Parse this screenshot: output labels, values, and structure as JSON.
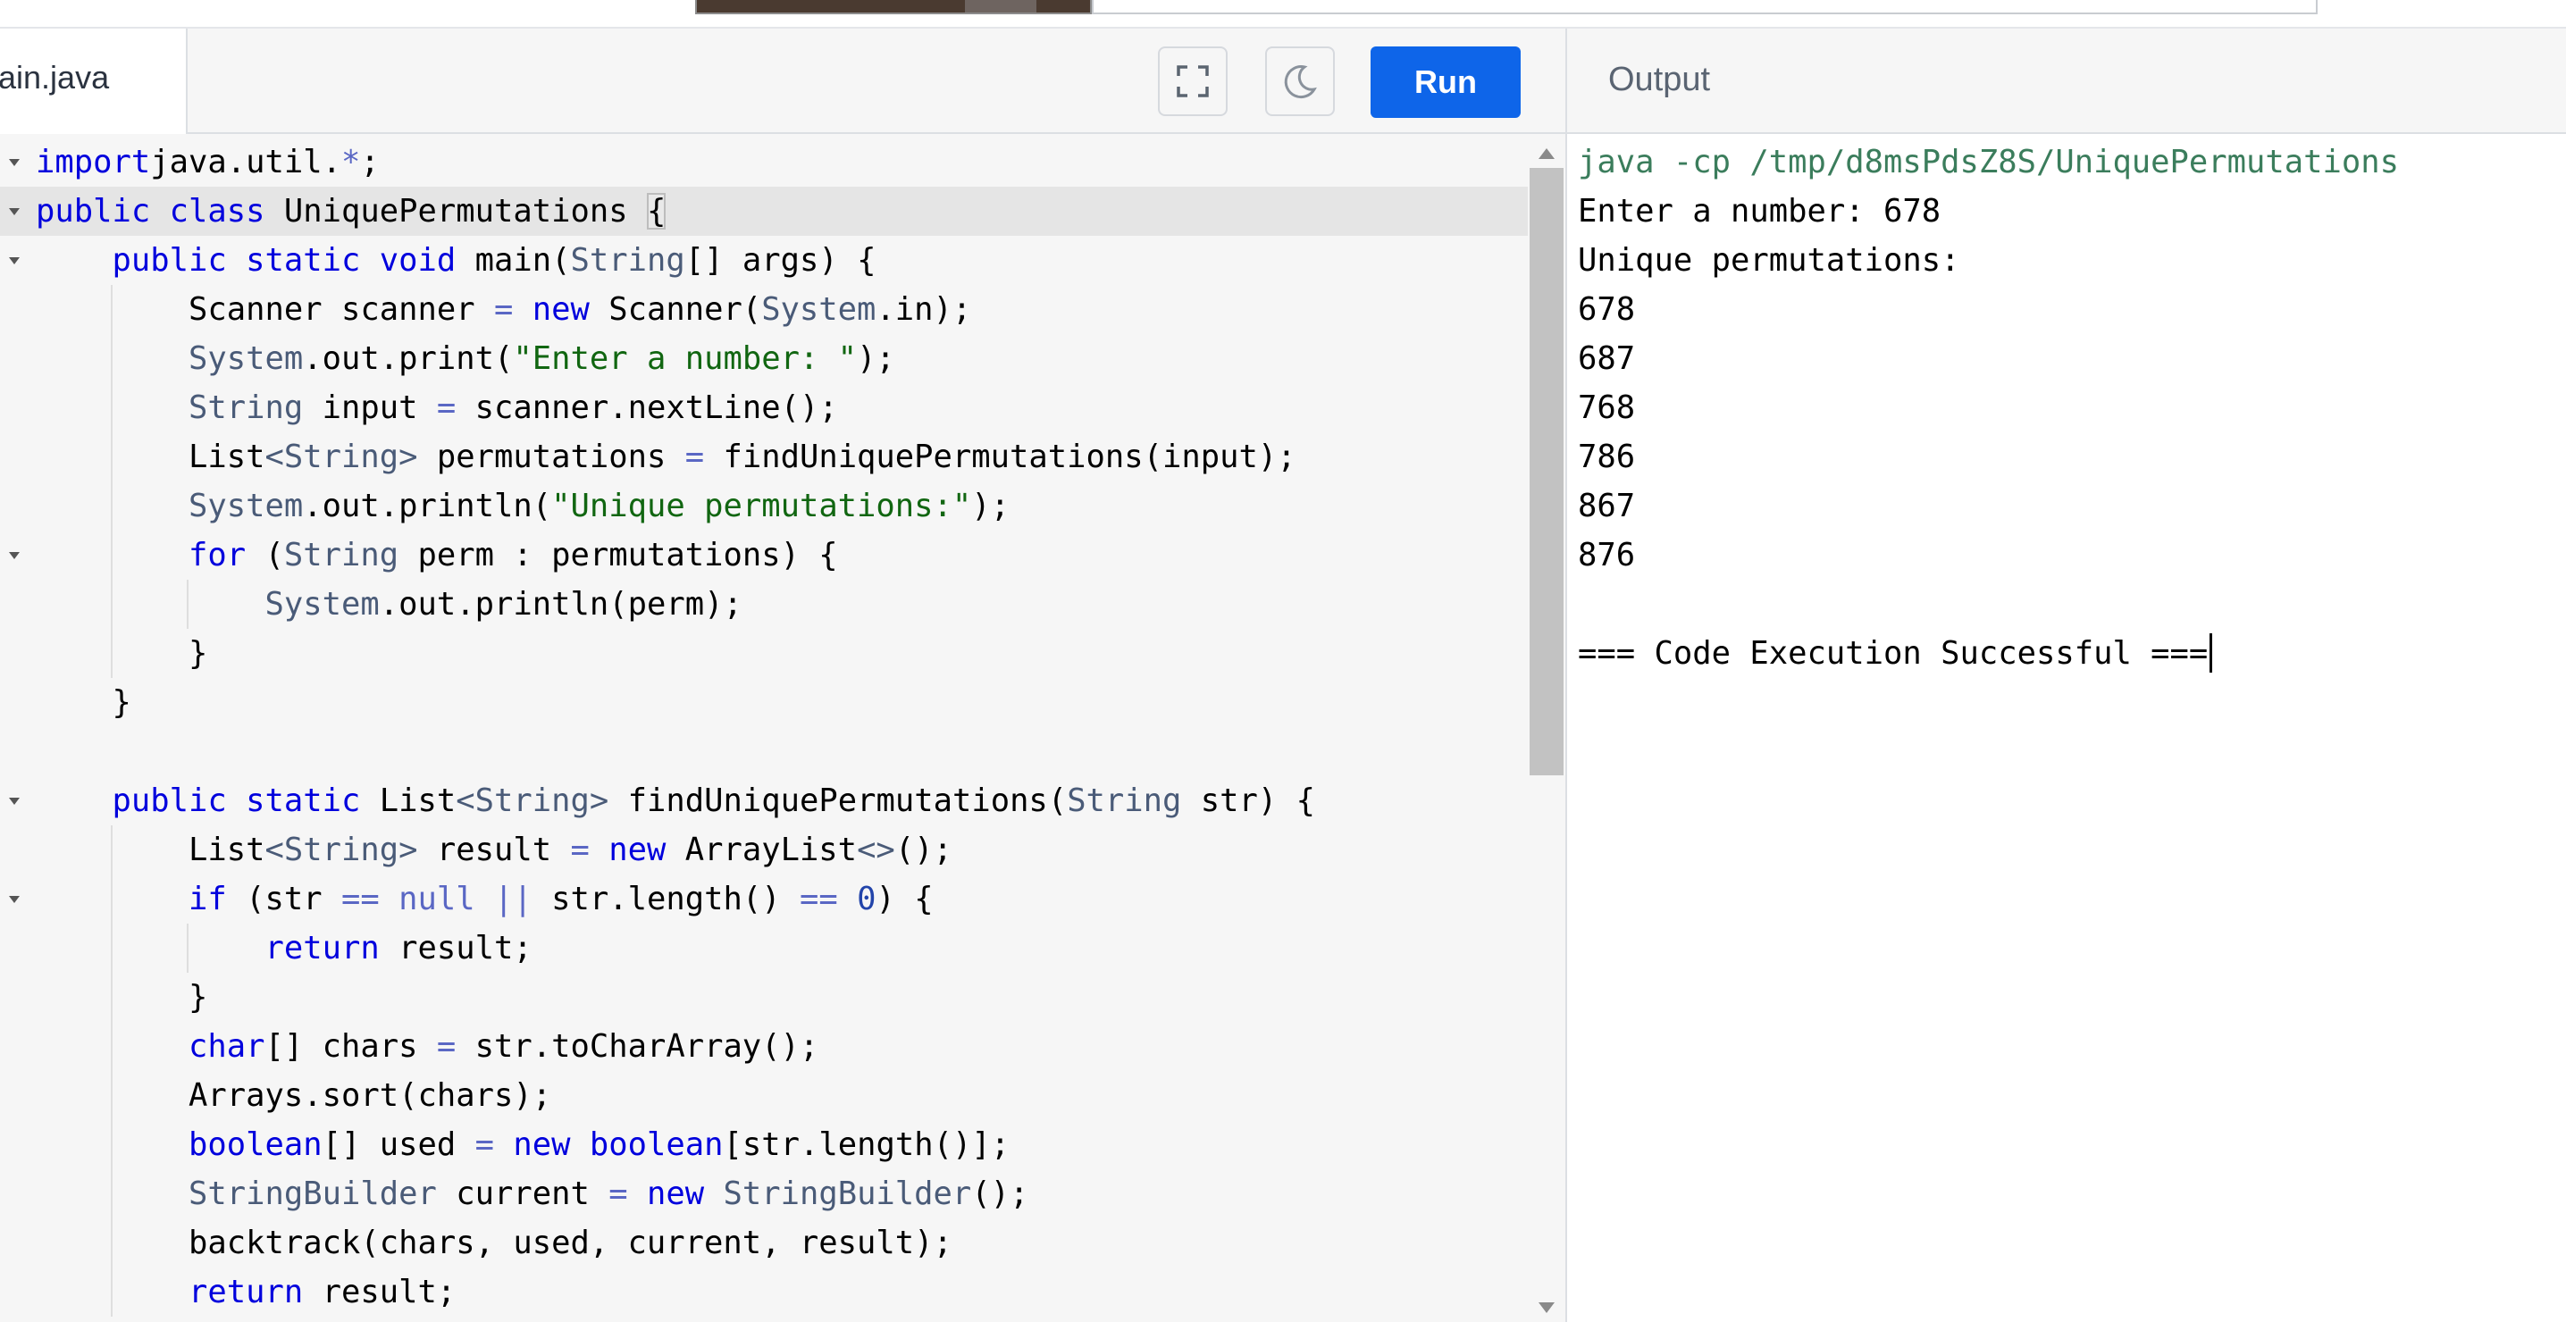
{
  "file_tab": {
    "label": "ain.java"
  },
  "toolbar": {
    "run_label": "Run",
    "fullscreen_icon": "fullscreen-icon",
    "theme_icon": "moon-icon"
  },
  "output": {
    "title": "Output",
    "lines": [
      "java -cp /tmp/d8msPdsZ8S/UniquePermutations",
      "Enter a number: 678",
      "Unique permutations:",
      "678",
      "687",
      "768",
      "786",
      "867",
      "876",
      "",
      "=== Code Execution Successful ==="
    ]
  },
  "colors": {
    "run_button": "#0e65e9",
    "keyword": "#0000dd",
    "type": "#4a5b78",
    "string": "#116611",
    "command_output": "#3b7d5c"
  },
  "code": [
    [
      [
        "kw",
        "import"
      ],
      [
        "",
        "java.util."
      ],
      [
        "op",
        "*"
      ],
      [
        "",
        ";"
      ]
    ],
    [
      [
        "kw",
        "public"
      ],
      [
        "",
        " "
      ],
      [
        "kw",
        "class"
      ],
      [
        "",
        " UniquePermutations "
      ],
      [
        "br",
        "{"
      ]
    ],
    [
      [
        "",
        "    "
      ],
      [
        "kw",
        "public"
      ],
      [
        "",
        " "
      ],
      [
        "kw",
        "static"
      ],
      [
        "",
        " "
      ],
      [
        "kw",
        "void"
      ],
      [
        "",
        " main("
      ],
      [
        "ty",
        "String"
      ],
      [
        "",
        "[] args) {"
      ]
    ],
    [
      [
        "",
        "        Scanner scanner "
      ],
      [
        "op",
        "="
      ],
      [
        "",
        " "
      ],
      [
        "kw",
        "new"
      ],
      [
        "",
        " Scanner("
      ],
      [
        "ty",
        "System"
      ],
      [
        "",
        ".in);"
      ]
    ],
    [
      [
        "",
        "        "
      ],
      [
        "ty",
        "System"
      ],
      [
        "",
        ".out.print("
      ],
      [
        "str",
        "\"Enter a number: \""
      ],
      [
        "",
        ");"
      ]
    ],
    [
      [
        "",
        "        "
      ],
      [
        "ty",
        "String"
      ],
      [
        "",
        ""
      ],
      [
        "",
        " input "
      ],
      [
        "op",
        "="
      ],
      [
        "",
        " scanner.nextLine();"
      ]
    ],
    [
      [
        "",
        "        List"
      ],
      [
        "ty",
        "<String>"
      ],
      [
        "",
        " permutations "
      ],
      [
        "op",
        "="
      ],
      [
        "",
        " findUniquePermutations(input);"
      ]
    ],
    [
      [
        "",
        "        "
      ],
      [
        "ty",
        "System"
      ],
      [
        "",
        ".out.println("
      ],
      [
        "str",
        "\"Unique permutations:\""
      ],
      [
        "",
        ");"
      ]
    ],
    [
      [
        "",
        "        "
      ],
      [
        "kw",
        "for"
      ],
      [
        "",
        " ("
      ],
      [
        "ty",
        "String"
      ],
      [
        "",
        " perm : permutations) {"
      ]
    ],
    [
      [
        "",
        "            "
      ],
      [
        "ty",
        "System"
      ],
      [
        "",
        ".out.println(perm);"
      ]
    ],
    [
      [
        "",
        "        }"
      ]
    ],
    [
      [
        "",
        "    }"
      ]
    ],
    [
      [
        "",
        ""
      ]
    ],
    [
      [
        "",
        "    "
      ],
      [
        "kw",
        "public"
      ],
      [
        "",
        " "
      ],
      [
        "kw",
        "static"
      ],
      [
        "",
        " List"
      ],
      [
        "ty",
        "<String>"
      ],
      [
        "",
        " findUniquePermutations("
      ],
      [
        "ty",
        "String"
      ],
      [
        "",
        " str) {"
      ]
    ],
    [
      [
        "",
        "        List"
      ],
      [
        "ty",
        "<String>"
      ],
      [
        "",
        " result "
      ],
      [
        "op",
        "="
      ],
      [
        "",
        " "
      ],
      [
        "kw",
        "new"
      ],
      [
        "",
        " ArrayList"
      ],
      [
        "ty",
        "<>"
      ],
      [
        "",
        "();"
      ]
    ],
    [
      [
        "",
        "        "
      ],
      [
        "kw",
        "if"
      ],
      [
        "",
        " (str "
      ],
      [
        "op",
        "=="
      ],
      [
        "",
        " "
      ],
      [
        "op",
        "null"
      ],
      [
        "",
        " "
      ],
      [
        "op",
        "||"
      ],
      [
        "",
        " str.length() "
      ],
      [
        "op",
        "=="
      ],
      [
        "",
        " "
      ],
      [
        "num",
        "0"
      ],
      [
        "",
        ") {"
      ]
    ],
    [
      [
        "",
        "            "
      ],
      [
        "kw",
        "return"
      ],
      [
        "",
        " result;"
      ]
    ],
    [
      [
        "",
        "        }"
      ]
    ],
    [
      [
        "",
        "        "
      ],
      [
        "kw",
        "char"
      ],
      [
        "",
        "[] chars "
      ],
      [
        "op",
        "="
      ],
      [
        "",
        " str.toCharArray();"
      ]
    ],
    [
      [
        "",
        "        Arrays.sort(chars);"
      ]
    ],
    [
      [
        "",
        "        "
      ],
      [
        "kw",
        "boolean"
      ],
      [
        "",
        "[] used "
      ],
      [
        "op",
        "="
      ],
      [
        "",
        " "
      ],
      [
        "kw",
        "new"
      ],
      [
        "",
        " "
      ],
      [
        "kw",
        "boolean"
      ],
      [
        "",
        "[str.length()];"
      ]
    ],
    [
      [
        "",
        "        "
      ],
      [
        "ty",
        "StringBuilder"
      ],
      [
        "",
        " current "
      ],
      [
        "op",
        "="
      ],
      [
        "",
        " "
      ],
      [
        "kw",
        "new"
      ],
      [
        "",
        " "
      ],
      [
        "ty",
        "StringBuilder"
      ],
      [
        "",
        "();"
      ]
    ],
    [
      [
        "",
        "        backtrack(chars, used, current, result);"
      ]
    ],
    [
      [
        "",
        "        "
      ],
      [
        "kw",
        "return"
      ],
      [
        "",
        " result;"
      ]
    ]
  ],
  "fold_lines": [
    0,
    1,
    2,
    8,
    13,
    15
  ],
  "active_line": 1,
  "guide_levels": [
    0,
    0,
    0,
    1,
    1,
    1,
    1,
    1,
    1,
    2,
    1,
    0,
    0,
    0,
    1,
    1,
    2,
    1,
    1,
    1,
    1,
    1,
    1,
    1
  ]
}
